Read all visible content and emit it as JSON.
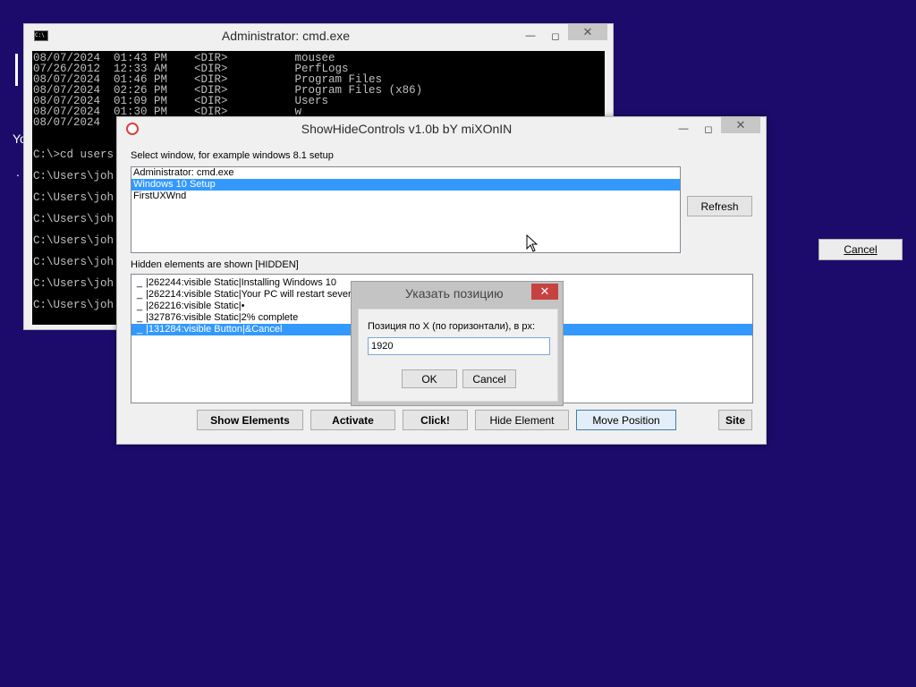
{
  "background": {
    "left_text": "Yo",
    "dots": ". .",
    "cancel_button": "Cancel"
  },
  "cmd": {
    "title": "Administrator: cmd.exe",
    "lines": [
      "08/07/2024  01:43 PM    <DIR>          mousee",
      "07/26/2012  12:33 AM    <DIR>          PerfLogs",
      "08/07/2024  01:46 PM    <DIR>          Program Files",
      "08/07/2024  02:26 PM    <DIR>          Program Files (x86)",
      "08/07/2024  01:09 PM    <DIR>          Users",
      "08/07/2024  01:30 PM    <DIR>          w",
      "08/07/2024",
      "",
      "",
      "C:\\>cd users",
      "",
      "C:\\Users\\joh",
      "",
      "C:\\Users\\joh",
      "",
      "C:\\Users\\joh",
      "",
      "C:\\Users\\joh",
      "",
      "C:\\Users\\joh",
      "",
      "C:\\Users\\joh",
      "",
      "C:\\Users\\joh"
    ]
  },
  "app": {
    "title": "ShowHideControls v1.0b bY miXOnIN",
    "select_label": "Select window, for example windows 8.1 setup",
    "windows": [
      {
        "text": "Administrator: cmd.exe",
        "selected": false
      },
      {
        "text": "Windows 10 Setup",
        "selected": true
      },
      {
        "text": "FirstUXWnd",
        "selected": false
      }
    ],
    "refresh": "Refresh",
    "hidden_label": "Hidden elements are shown [HIDDEN]",
    "elements": [
      {
        "check": "_",
        "text": "|262244:visible Static|Installing Windows 10",
        "selected": false
      },
      {
        "check": "_",
        "text": "|262214:visible Static|Your PC will restart several times. This might take a while.",
        "selected": false
      },
      {
        "check": "_",
        "text": "|262216:visible Static|•",
        "selected": false
      },
      {
        "check": "_",
        "text": "|327876:visible Static|2% complete",
        "selected": false
      },
      {
        "check": "_",
        "text": "|131284:visible Button|&Cancel",
        "selected": true
      }
    ],
    "buttons": {
      "show_elements": "Show Elements",
      "activate": "Activate",
      "click": "Click!",
      "hide_element": "Hide Element",
      "move_position": "Move Position",
      "site": "Site"
    }
  },
  "dialog": {
    "title": "Указать позицию",
    "prompt": "Позиция по X (по горизонтали), в px:",
    "value": "1920",
    "ok": "OK",
    "cancel": "Cancel"
  }
}
